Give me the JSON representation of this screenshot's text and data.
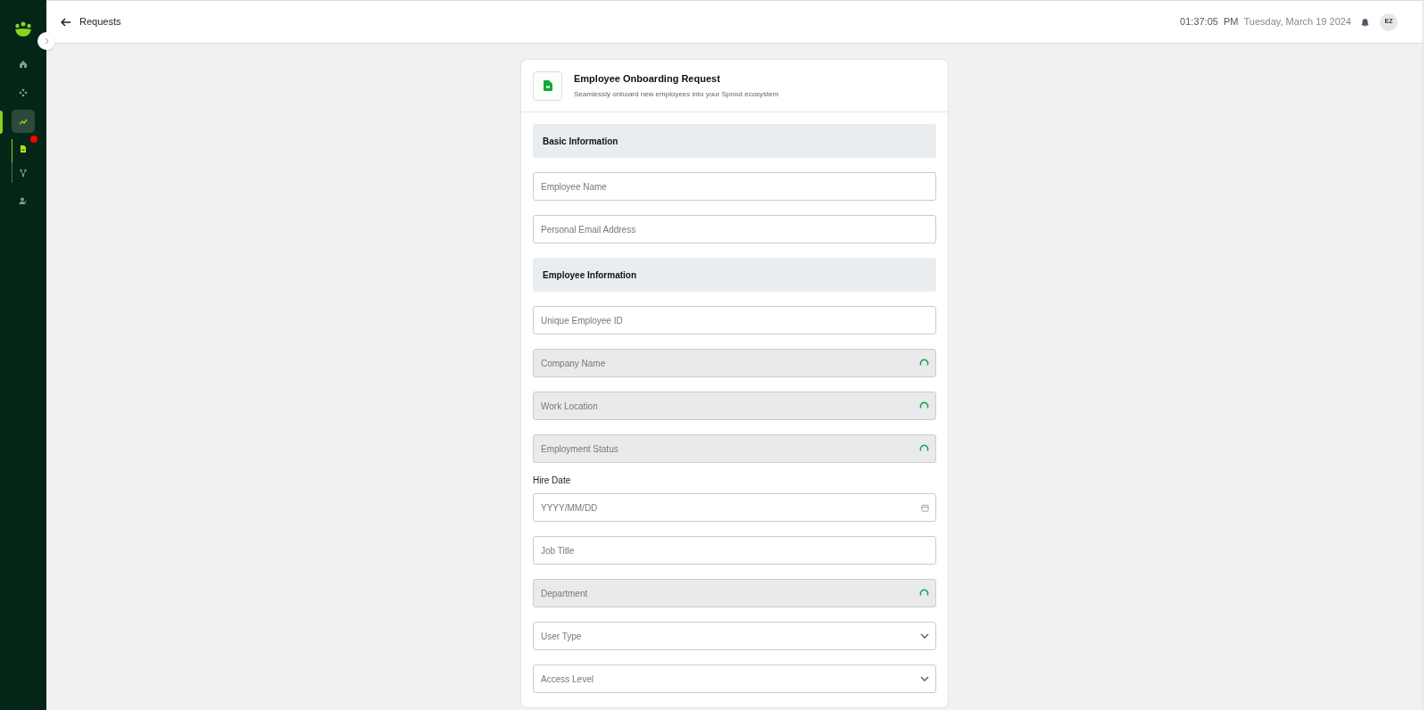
{
  "sidebar": {
    "items": [
      {
        "kind": "home",
        "selected": false,
        "notification": false
      },
      {
        "kind": "nodes",
        "selected": false,
        "notification": false
      },
      {
        "kind": "chart",
        "selected": true,
        "notification": false,
        "children": [
          {
            "kind": "document",
            "selected": true,
            "notification": true
          },
          {
            "kind": "branch",
            "selected": false,
            "notification": false
          }
        ]
      },
      {
        "kind": "user",
        "selected": false,
        "notification": false
      }
    ]
  },
  "header": {
    "title": "Requests",
    "time": "01:37:05",
    "meridiem": "PM",
    "date": "Tuesday, March 19 2024",
    "avatar": "EZ"
  },
  "form": {
    "title": "Employee Onboarding Request",
    "subtitle": "Seamlessly onboard new employees into your Sprout ecosystem",
    "fields": [
      {
        "kind": "section",
        "label": "Basic Information"
      },
      {
        "kind": "text",
        "placeholder": "Employee Name"
      },
      {
        "kind": "text",
        "placeholder": "Personal Email Address"
      },
      {
        "kind": "section",
        "label": "Employee Information"
      },
      {
        "kind": "text",
        "placeholder": "Unique Employee ID"
      },
      {
        "kind": "loading",
        "placeholder": "Company Name"
      },
      {
        "kind": "loading",
        "placeholder": "Work Location"
      },
      {
        "kind": "loading",
        "placeholder": "Employment Status"
      },
      {
        "kind": "date",
        "label": "Hire Date",
        "placeholder": "YYYY/MM/DD"
      },
      {
        "kind": "text",
        "placeholder": "Job Title"
      },
      {
        "kind": "loading",
        "placeholder": "Department"
      },
      {
        "kind": "select",
        "placeholder": "User Type"
      },
      {
        "kind": "select",
        "placeholder": "Access Level"
      }
    ]
  }
}
